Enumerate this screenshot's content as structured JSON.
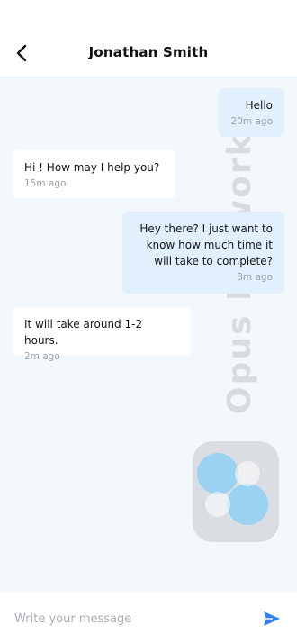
{
  "header": {
    "title": "Jonathan Smith"
  },
  "messages": [
    {
      "direction": "out",
      "text": "Hello",
      "time": "20m ago"
    },
    {
      "direction": "in",
      "text": "Hi ! How may I help you?",
      "time": "15m ago"
    },
    {
      "direction": "out",
      "text": "Hey there? I just want to know how much time it will take to complete?",
      "time": "8m ago"
    },
    {
      "direction": "in",
      "text": "It will take around 1-2 hours.",
      "time": "2m ago"
    }
  ],
  "watermark": {
    "text": "Opus Labworks"
  },
  "composer": {
    "placeholder": "Write your message"
  },
  "colors": {
    "accent": "#2f80ed",
    "outgoing_bubble": "#e2f0fd",
    "incoming_bubble": "#ffffff",
    "background": "#f3f8fc"
  },
  "icons": {
    "back": "chevron-left-icon",
    "send": "send-icon"
  }
}
